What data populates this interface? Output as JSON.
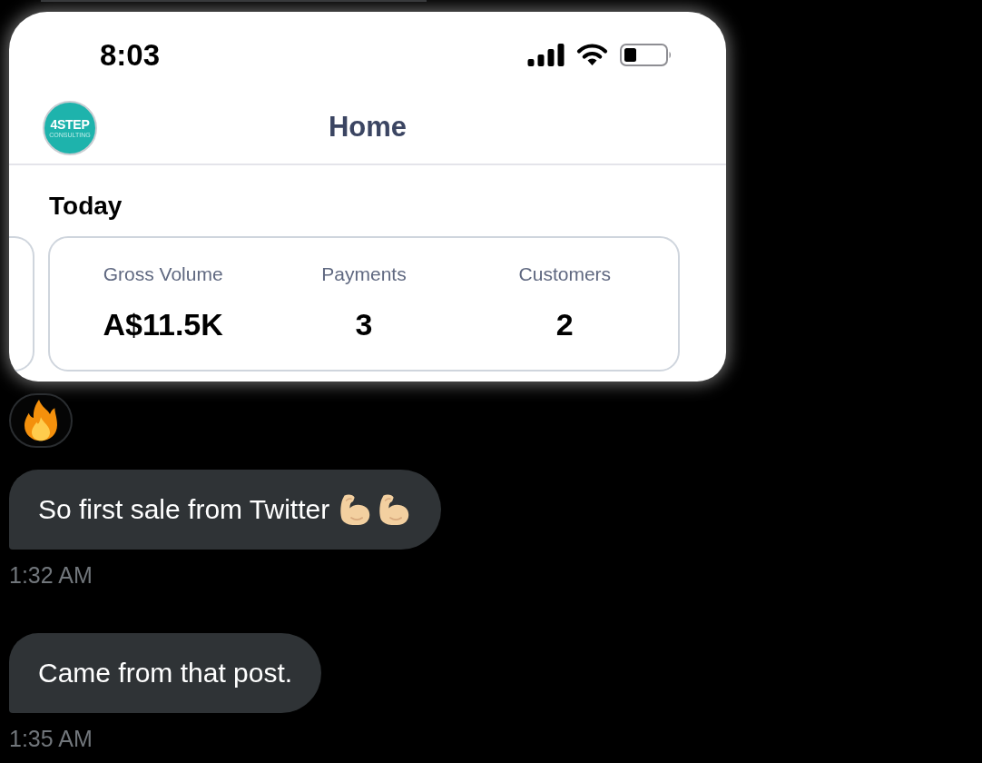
{
  "shared_image": {
    "status_bar": {
      "time": "8:03"
    },
    "header": {
      "logo": {
        "text": "4STEP",
        "subtext": "CONSULTING"
      },
      "title": "Home"
    },
    "today": {
      "title": "Today",
      "stats": [
        {
          "label": "Gross Volume",
          "value": "A$11.5K"
        },
        {
          "label": "Payments",
          "value": "3"
        },
        {
          "label": "Customers",
          "value": "2"
        }
      ]
    },
    "reaction": {
      "kind": "fire"
    }
  },
  "messages": [
    {
      "text": "So first sale from Twitter",
      "emojis": [
        {
          "kind": "biceps"
        },
        {
          "kind": "biceps"
        }
      ],
      "time": "1:32 AM"
    },
    {
      "text": "Came from that post.",
      "time": "1:35 AM"
    }
  ]
}
